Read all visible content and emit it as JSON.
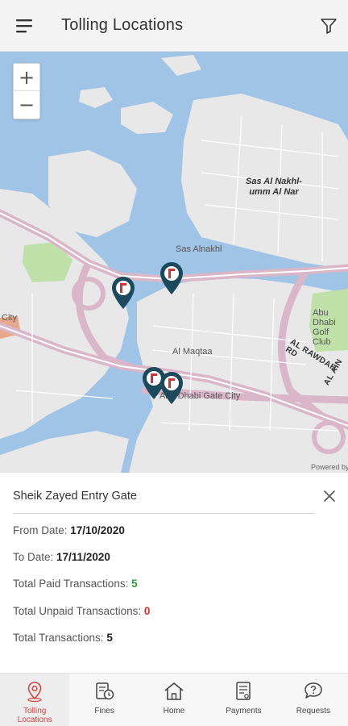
{
  "header": {
    "title": "Tolling Locations",
    "menu_icon": "hamburger-menu-icon",
    "filter_icon": "filter-funnel-icon"
  },
  "map": {
    "zoom_in": "+",
    "zoom_out": "−",
    "labels": {
      "area1": "Sas Al Nakhl-umm Al Nar",
      "area2": "Sas Alnakhl",
      "area3": "Al Maqtaa",
      "area4": "Abu Dhabi Gate City",
      "area5": "Abu Dhabi Golf Club",
      "area6": "City",
      "road1": "AL RAWDAH RD",
      "road2": "AL AIN",
      "credit": "Powered by Esri"
    },
    "pin_icon": "toll-location-pin-icon",
    "colors": {
      "water": "#9fc4e6",
      "land": "#e8e8e8",
      "road": "#d9b6c8",
      "park": "#bfe0a8",
      "pin": "#1a4a5c",
      "pin_mark": "#d93030"
    }
  },
  "info": {
    "title": "Sheik Zayed Entry Gate",
    "from_label": "From Date: ",
    "from_value": "17/10/2020",
    "to_label": "To Date: ",
    "to_value": "17/11/2020",
    "paid_label": "Total Paid Transactions: ",
    "paid_value": "5",
    "unpaid_label": "Total Unpaid Transactions: ",
    "unpaid_value": "0",
    "total_label": "Total Transactions: ",
    "total_value": "5"
  },
  "nav": {
    "items": [
      {
        "label_line1": "Tolling",
        "label_line2": "Locations",
        "icon": "location-pin-icon"
      },
      {
        "label": "Fines",
        "icon": "fines-icon"
      },
      {
        "label": "Home",
        "icon": "home-icon"
      },
      {
        "label": "Payments",
        "icon": "payments-icon"
      },
      {
        "label": "Requests",
        "icon": "requests-icon"
      }
    ],
    "active_color": "#d64545"
  }
}
